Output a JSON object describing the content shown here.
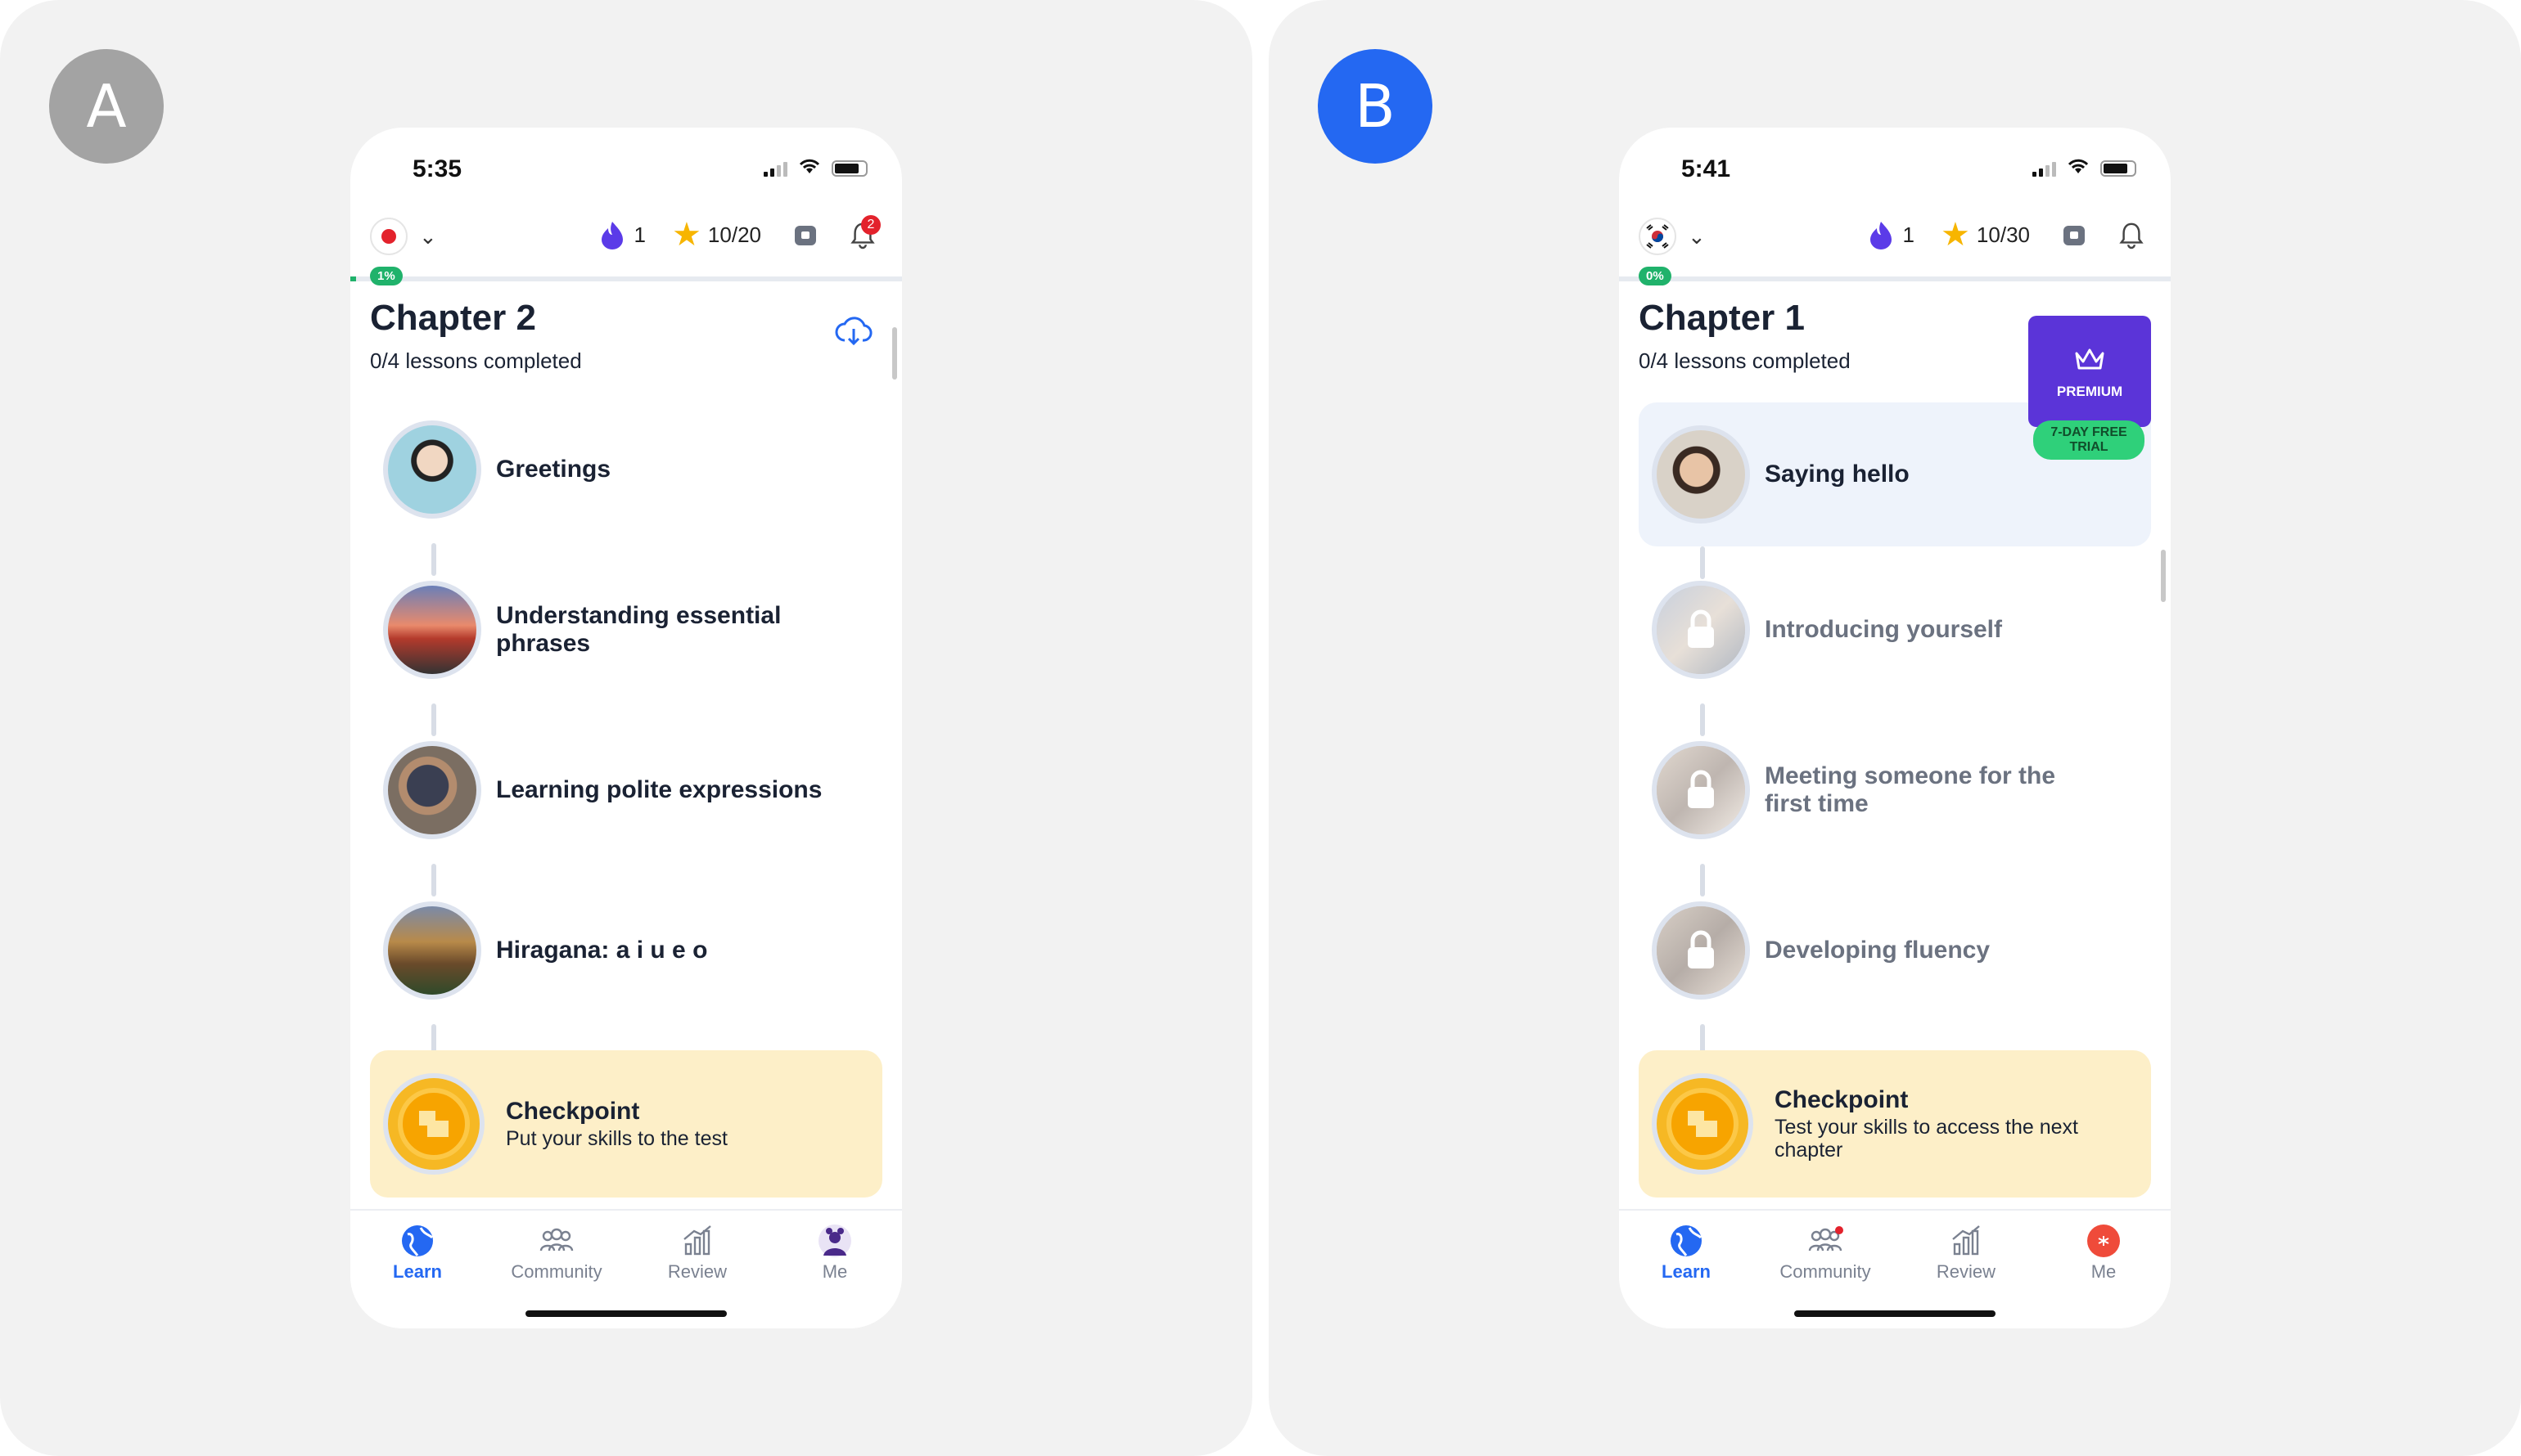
{
  "panels": {
    "a": {
      "letter": "A",
      "letter_bg": "#a3a3a3",
      "time": "5:35",
      "flag": "japan-flag",
      "streak": "1",
      "stars": "10/20",
      "notifications": "2",
      "progress_badge": "1%",
      "chapter_title": "Chapter 2",
      "chapter_sub": "0/4 lessons completed",
      "lessons": [
        {
          "name": "Greetings"
        },
        {
          "name": "Understanding essential phrases"
        },
        {
          "name": "Learning polite expressions"
        },
        {
          "name": "Hiragana: a i u e o"
        }
      ],
      "checkpoint": {
        "title": "Checkpoint",
        "sub": "Put your skills to the test"
      },
      "tabs": [
        "Learn",
        "Community",
        "Review",
        "Me"
      ]
    },
    "b": {
      "letter": "B",
      "letter_bg": "#2468f2",
      "time": "5:41",
      "flag": "korea-flag",
      "streak": "1",
      "stars": "10/30",
      "progress_badge": "0%",
      "chapter_title": "Chapter 1",
      "chapter_sub": "0/4 lessons completed",
      "premium": "PREMIUM",
      "trial": "7-DAY FREE TRIAL",
      "lessons": [
        {
          "name": "Saying hello"
        },
        {
          "name": "Introducing yourself"
        },
        {
          "name": "Meeting someone for the first time"
        },
        {
          "name": "Developing fluency"
        }
      ],
      "checkpoint": {
        "title": "Checkpoint",
        "sub": "Test your skills to access the next chapter"
      },
      "tabs": [
        "Learn",
        "Community",
        "Review",
        "Me"
      ]
    }
  },
  "colors": {
    "accent": "#2468f2",
    "premium": "#5b34d8",
    "trial": "#2fd07a",
    "checkpoint_bg": "#fdefc8",
    "progress": "#20b26b"
  }
}
